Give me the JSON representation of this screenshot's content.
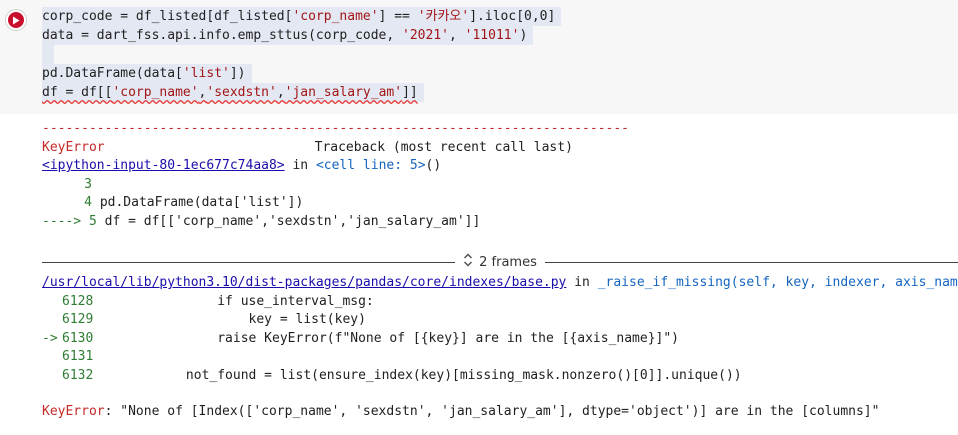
{
  "cell": {
    "code_lines": [
      [
        "corp_code = df_listed[df_listed[",
        "'corp_name'",
        "] == ",
        "'카카오'",
        "].iloc[0,0]"
      ],
      [
        "data = dart_fss.api.info.emp_sttus(corp_code, ",
        "'2021'",
        ", ",
        "'11011'",
        ")"
      ],
      [
        ""
      ],
      [
        "pd.DataFrame(data[",
        "'list'",
        "])"
      ],
      [
        "df = df[[",
        "'corp_name'",
        ",",
        "'sexdstn'",
        ",",
        "'jan_salary_am'",
        "]]"
      ]
    ]
  },
  "output": {
    "dashes": "---------------------------------------------------------------------------",
    "err_name": "KeyError",
    "traceback_header": "Traceback (most recent call last)",
    "input_link": "<ipython-input-80-1ec677c74aa8>",
    "in_word": " in ",
    "cell_line": "<cell line: 5>",
    "cell_line_paren": "()",
    "src1_no": "3",
    "src2_no": "4",
    "src2_text": " pd.DataFrame(data['list'])",
    "src3_arrow": "----> 5",
    "src3_text": " df = df[['corp_name','sexdstn','jan_salary_am']]",
    "frames_label": "2 frames",
    "lib_path": "/usr/local/lib/python3.10/dist-packages/pandas/core/indexes/base.py",
    "lib_func": "_raise_if_missing",
    "lib_args": "(self, key, indexer, axis_name)",
    "lib_lines": [
      {
        "no": "6128",
        "prefix": "",
        "code": "                if use_interval_msg:"
      },
      {
        "no": "6129",
        "prefix": "",
        "code": "                    key = list(key)"
      },
      {
        "no": "6130",
        "prefix": "-> ",
        "code": "                raise KeyError(f\"None of [{key}] are in the [{axis_name}]\")"
      },
      {
        "no": "6131",
        "prefix": "",
        "code": ""
      },
      {
        "no": "6132",
        "prefix": "",
        "code": "            not_found = list(ensure_index(key)[missing_mask.nonzero()[0]].unique())"
      }
    ],
    "final_err_name": "KeyError",
    "final_err_msg": ": \"None of [Index(['corp_name', 'sexdstn', 'jan_salary_am'], dtype='object')] are in the [columns]\""
  }
}
